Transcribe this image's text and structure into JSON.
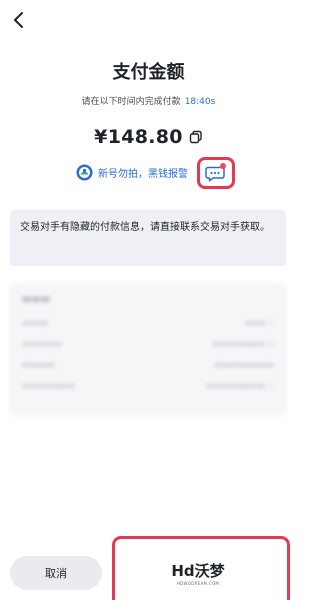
{
  "header": {
    "back_icon": "chevron-left-icon",
    "title": "支付金额"
  },
  "timer": {
    "label": "请在以下时间内完成付款",
    "countdown": "18:40s"
  },
  "amount": {
    "value": "¥148.80",
    "copy_icon": "copy-icon"
  },
  "warning": {
    "text": "新号勿拍，黑钱报警",
    "link_color": "#2a6bd8"
  },
  "chat": {
    "icon": "chat-icon",
    "has_unread": true,
    "highlight_color": "#e33a53"
  },
  "notice": {
    "text": "交易对手有隐藏的付款信息，请直接联系交易对手获取。"
  },
  "footer": {
    "cancel_label": "取消"
  },
  "watermark": {
    "logo_text": "Hd沃梦",
    "site": "HDWODREAM.COM"
  }
}
